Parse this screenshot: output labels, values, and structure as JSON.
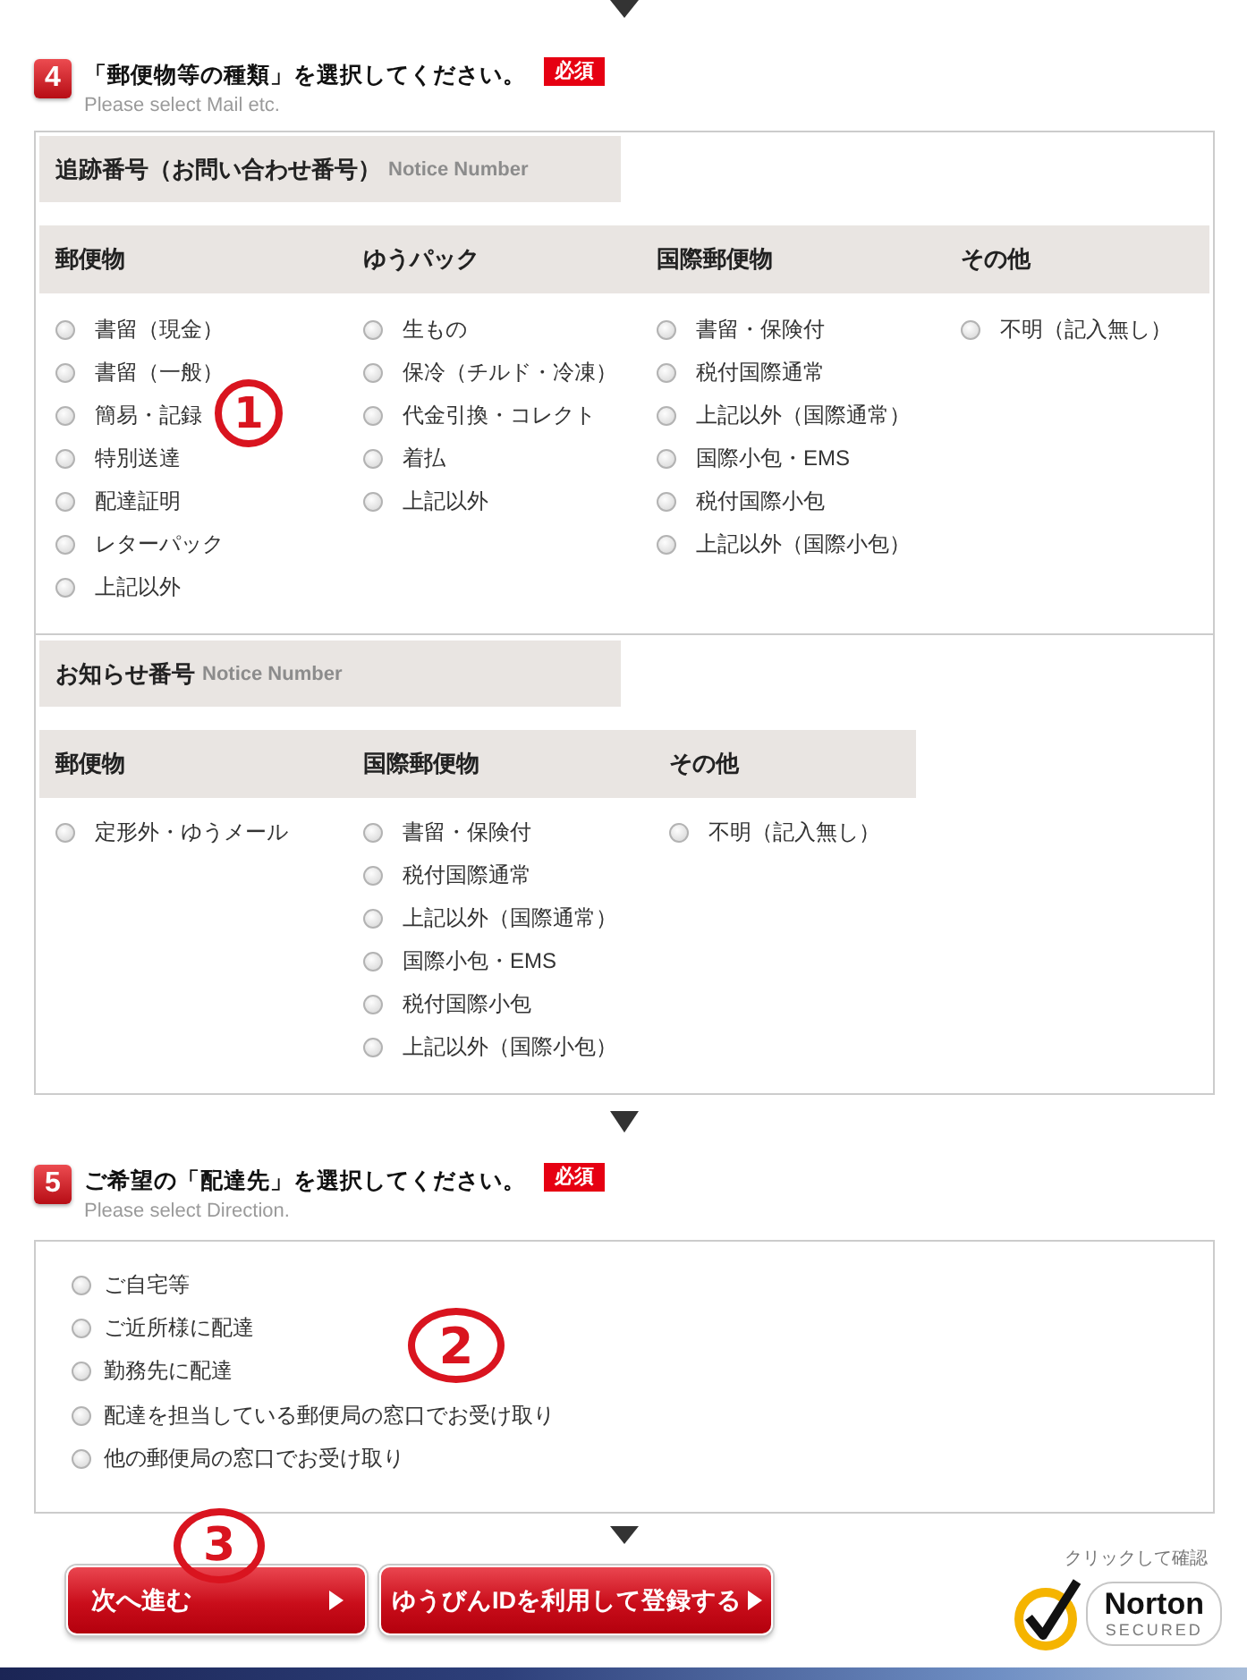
{
  "mail_section": {
    "number": "4",
    "title": "「郵便物等の種類」を選択してください。",
    "required_tag": "必須",
    "subtitle": "Please select Mail etc.",
    "groups": [
      {
        "heading": "追跡番号（お問い合わせ番号）",
        "heading_en": "Notice Number",
        "annotation": "1",
        "columns": [
          {
            "header": "郵便物",
            "options": [
              {
                "label": "書留（現金）",
                "selected": false
              },
              {
                "label": "書留（一般）",
                "selected": false
              },
              {
                "label": "簡易・記録",
                "selected": false
              },
              {
                "label": "特別送達",
                "selected": false
              },
              {
                "label": "配達証明",
                "selected": false
              },
              {
                "label": "レターパック",
                "selected": false
              },
              {
                "label": "上記以外",
                "selected": false
              }
            ]
          },
          {
            "header": "ゆうパック",
            "options": [
              {
                "label": "生もの",
                "selected": false
              },
              {
                "label": "保冷（チルド・冷凍）",
                "selected": false
              },
              {
                "label": "代金引換・コレクト",
                "selected": false
              },
              {
                "label": "着払",
                "selected": false
              },
              {
                "label": "上記以外",
                "selected": false
              }
            ]
          },
          {
            "header": "国際郵便物",
            "options": [
              {
                "label": "書留・保険付",
                "selected": false
              },
              {
                "label": "税付国際通常",
                "selected": false
              },
              {
                "label": "上記以外（国際通常）",
                "selected": false
              },
              {
                "label": "国際小包・EMS",
                "selected": false
              },
              {
                "label": "税付国際小包",
                "selected": false
              },
              {
                "label": "上記以外（国際小包）",
                "selected": false
              }
            ]
          },
          {
            "header": "その他",
            "options": [
              {
                "label": "不明（記入無し）",
                "selected": false
              }
            ]
          }
        ]
      },
      {
        "heading": "お知らせ番号",
        "heading_en": "Notice Number",
        "columns": [
          {
            "header": "郵便物",
            "options": [
              {
                "label": "定形外・ゆうメール",
                "selected": false
              }
            ]
          },
          {
            "header": "国際郵便物",
            "options": [
              {
                "label": "書留・保険付",
                "selected": false
              },
              {
                "label": "税付国際通常",
                "selected": false
              },
              {
                "label": "上記以外（国際通常）",
                "selected": false
              },
              {
                "label": "国際小包・EMS",
                "selected": false
              },
              {
                "label": "税付国際小包",
                "selected": false
              },
              {
                "label": "上記以外（国際小包）",
                "selected": false
              }
            ]
          },
          {
            "header": "その他",
            "options": [
              {
                "label": "不明（記入無し）",
                "selected": false
              }
            ]
          }
        ]
      }
    ]
  },
  "direction_section": {
    "number": "5",
    "title": "ご希望の「配達先」を選択してください。",
    "required_tag": "必須",
    "subtitle": "Please select Direction.",
    "annotation": "2",
    "options": [
      {
        "label": "ご自宅等",
        "selected": false
      },
      {
        "label": "ご近所様に配達",
        "selected": false
      },
      {
        "label": "勤務先に配達",
        "selected": false
      },
      {
        "label": "配達を担当している郵便局の窓口でお受け取り",
        "selected": false
      },
      {
        "label": "他の郵便局の窓口でお受け取り",
        "selected": false
      }
    ]
  },
  "buttons": [
    {
      "label": "次へ進む",
      "annotation": "3"
    },
    {
      "label": "ゆうびんIDを利用して登録する"
    }
  ],
  "norton_seal": {
    "caption": "クリックして確認",
    "brand": "Norton",
    "tagline": "SECURED"
  }
}
